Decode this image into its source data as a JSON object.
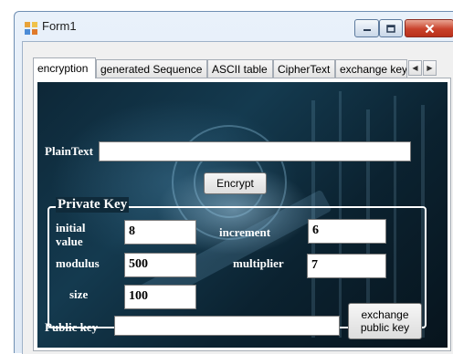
{
  "window": {
    "title": "Form1",
    "icon": "form-app-icon"
  },
  "tabs": [
    {
      "label": "encryption",
      "active": true
    },
    {
      "label": "generated Sequence",
      "active": false
    },
    {
      "label": "ASCII table",
      "active": false
    },
    {
      "label": "CipherText",
      "active": false
    },
    {
      "label": "exchange key",
      "active": false
    }
  ],
  "form": {
    "plaintext_label": "PlainText",
    "plaintext_value": "",
    "encrypt_button": "Encrypt",
    "private_key": {
      "legend": "Private Key",
      "initial_value_label_1": "initial",
      "initial_value_label_2": "value",
      "initial_value": "8",
      "increment_label": "increment",
      "increment": "6",
      "modulus_label": "modulus",
      "modulus": "500",
      "multiplier_label": "multiplier",
      "multiplier": "7",
      "size_label": "size",
      "size": "100"
    },
    "public_key_label": "Public key",
    "public_key_value": "",
    "exchange_button_line1": "exchange",
    "exchange_button_line2": "public key"
  },
  "colors": {
    "title_bar": "#dfe9f5",
    "close_button": "#c8412a",
    "background_image": "#0f2a3a"
  }
}
